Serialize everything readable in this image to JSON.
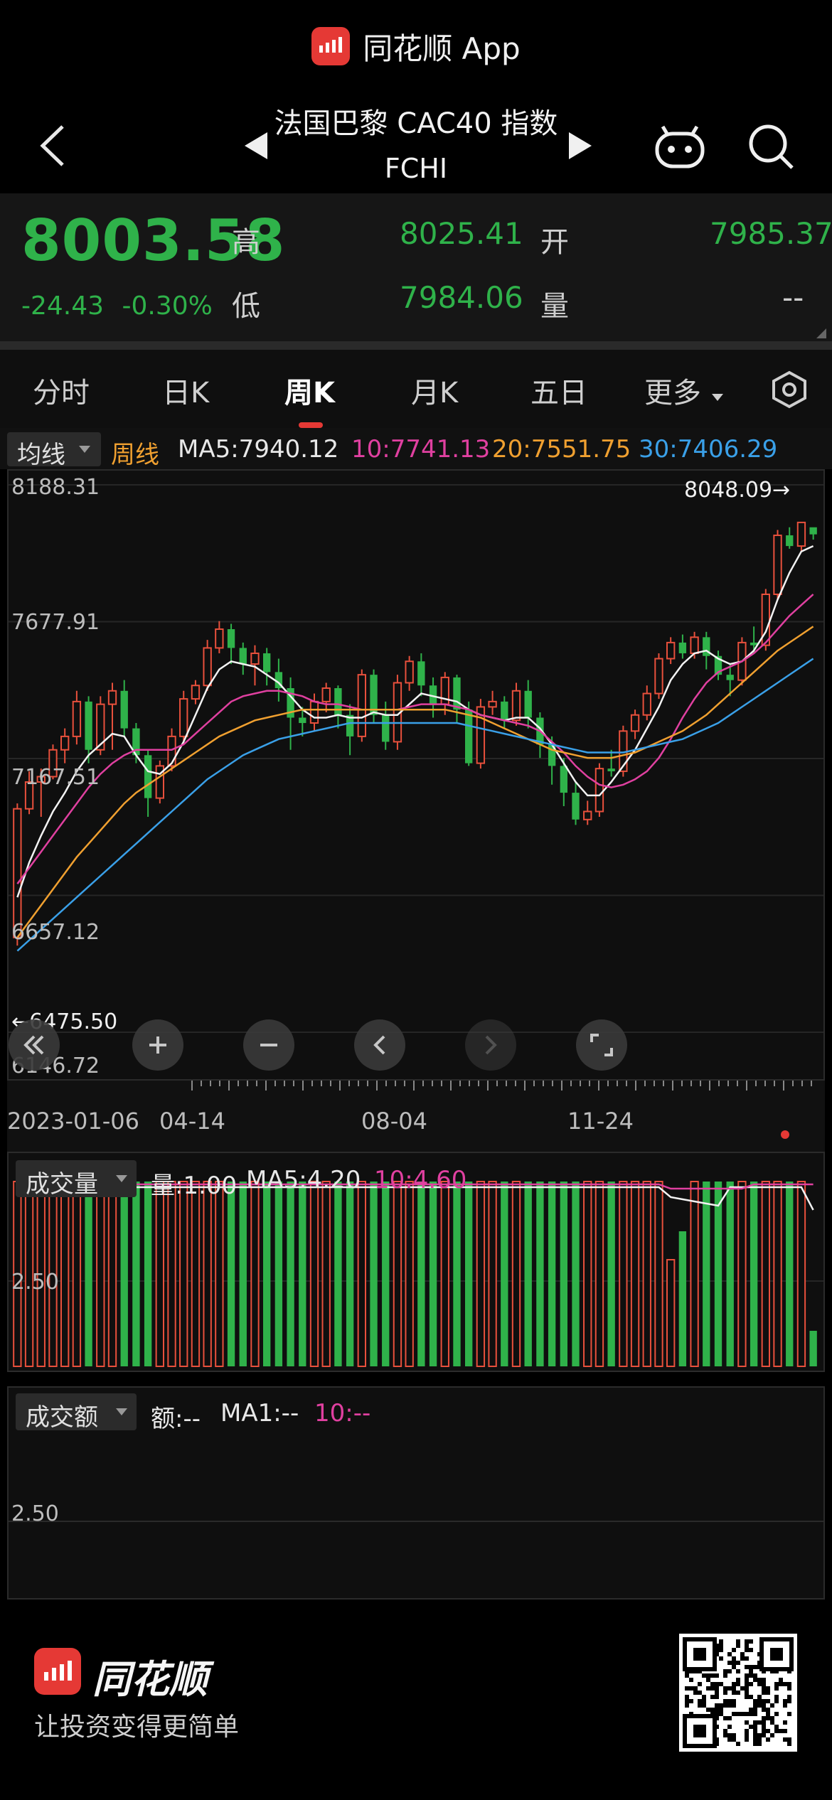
{
  "app": {
    "title": "同花顺 App"
  },
  "nav": {
    "title": "法国巴黎 CAC40 指数",
    "code": "FCHI"
  },
  "quote": {
    "price": "8003.58",
    "change": "-24.43",
    "change_pct": "-0.30%",
    "high_label": "高",
    "high": "8025.41",
    "open_label": "开",
    "open": "7985.37",
    "low_label": "低",
    "low": "7984.06",
    "volume_label": "量",
    "volume": "--"
  },
  "tabs": [
    {
      "label": "分时"
    },
    {
      "label": "日K"
    },
    {
      "label": "周K"
    },
    {
      "label": "月K"
    },
    {
      "label": "五日"
    },
    {
      "label": "更多"
    }
  ],
  "ma_row": {
    "dropdown": "均线",
    "period": "周线",
    "ma5": "MA5:7940.12",
    "ma10": "10:7741.13",
    "ma20": "20:7551.75",
    "ma30": "30:7406.29"
  },
  "colors": {
    "up": "#e8503c",
    "down": "#2fb24a",
    "ma5": "#f2f2f2",
    "ma10": "#e040a0",
    "ma20": "#f0a030",
    "ma30": "#3aa0e8",
    "accent": "#e53935"
  },
  "chart_data": {
    "type": "candlestick",
    "yaxis_labels": [
      "8188.31",
      "7677.91",
      "7167.51",
      "6657.12",
      "6146.72"
    ],
    "ylim": [
      6146.72,
      8188.31
    ],
    "max_marker": "8048.09→",
    "min_marker": "←6475.50",
    "date_labels": [
      "2023-01-06",
      "04-14",
      "08-04",
      "11-24"
    ],
    "candles": [
      [
        6500,
        6980,
        6470,
        7000
      ],
      [
        6980,
        7080,
        6960,
        7120
      ],
      [
        7080,
        7100,
        6950,
        7130
      ],
      [
        7100,
        7200,
        7090,
        7220
      ],
      [
        7200,
        7250,
        7150,
        7280
      ],
      [
        7250,
        7380,
        7220,
        7420
      ],
      [
        7380,
        7200,
        7150,
        7400
      ],
      [
        7200,
        7370,
        7180,
        7400
      ],
      [
        7370,
        7420,
        7200,
        7450
      ],
      [
        7420,
        7280,
        7250,
        7460
      ],
      [
        7280,
        7180,
        7150,
        7300
      ],
      [
        7180,
        7020,
        6950,
        7200
      ],
      [
        7020,
        7140,
        7000,
        7160
      ],
      [
        7140,
        7250,
        7120,
        7280
      ],
      [
        7250,
        7390,
        7230,
        7420
      ],
      [
        7390,
        7440,
        7370,
        7460
      ],
      [
        7440,
        7580,
        7420,
        7610
      ],
      [
        7580,
        7650,
        7560,
        7680
      ],
      [
        7650,
        7580,
        7520,
        7670
      ],
      [
        7580,
        7520,
        7480,
        7600
      ],
      [
        7520,
        7560,
        7440,
        7590
      ],
      [
        7560,
        7490,
        7440,
        7580
      ],
      [
        7490,
        7430,
        7380,
        7540
      ],
      [
        7430,
        7320,
        7200,
        7470
      ],
      [
        7320,
        7300,
        7250,
        7360
      ],
      [
        7300,
        7380,
        7270,
        7410
      ],
      [
        7380,
        7430,
        7340,
        7450
      ],
      [
        7430,
        7330,
        7280,
        7440
      ],
      [
        7330,
        7250,
        7180,
        7370
      ],
      [
        7250,
        7480,
        7230,
        7500
      ],
      [
        7480,
        7330,
        7300,
        7500
      ],
      [
        7330,
        7230,
        7200,
        7380
      ],
      [
        7230,
        7450,
        7200,
        7480
      ],
      [
        7450,
        7530,
        7420,
        7550
      ],
      [
        7530,
        7440,
        7400,
        7560
      ],
      [
        7440,
        7370,
        7320,
        7470
      ],
      [
        7370,
        7470,
        7330,
        7490
      ],
      [
        7470,
        7350,
        7300,
        7480
      ],
      [
        7350,
        7150,
        7140,
        7380
      ],
      [
        7150,
        7360,
        7130,
        7390
      ],
      [
        7360,
        7380,
        7330,
        7420
      ],
      [
        7380,
        7310,
        7280,
        7400
      ],
      [
        7310,
        7420,
        7290,
        7450
      ],
      [
        7420,
        7320,
        7280,
        7460
      ],
      [
        7320,
        7220,
        7170,
        7340
      ],
      [
        7220,
        7140,
        7070,
        7250
      ],
      [
        7140,
        7040,
        6990,
        7170
      ],
      [
        7040,
        6940,
        6920,
        7080
      ],
      [
        6940,
        6970,
        6920,
        7010
      ],
      [
        6970,
        7130,
        6950,
        7150
      ],
      [
        7130,
        7120,
        7100,
        7200
      ],
      [
        7120,
        7270,
        7100,
        7290
      ],
      [
        7270,
        7330,
        7240,
        7350
      ],
      [
        7330,
        7410,
        7310,
        7440
      ],
      [
        7410,
        7540,
        7390,
        7560
      ],
      [
        7540,
        7600,
        7520,
        7620
      ],
      [
        7600,
        7560,
        7540,
        7630
      ],
      [
        7560,
        7620,
        7540,
        7640
      ],
      [
        7620,
        7550,
        7500,
        7640
      ],
      [
        7550,
        7480,
        7460,
        7570
      ],
      [
        7480,
        7460,
        7400,
        7520
      ],
      [
        7460,
        7600,
        7440,
        7620
      ],
      [
        7600,
        7590,
        7560,
        7660
      ],
      [
        7590,
        7780,
        7570,
        7800
      ],
      [
        7780,
        8000,
        7760,
        8020
      ],
      [
        8000,
        7960,
        7950,
        8030
      ],
      [
        7960,
        8048.09,
        7940,
        8048.09
      ],
      [
        8030,
        8003.58,
        7984.06,
        8025.41
      ]
    ],
    "ma_lines": {
      "ma5": [
        6650,
        6780,
        6880,
        6970,
        7040,
        7120,
        7180,
        7220,
        7260,
        7250,
        7180,
        7120,
        7110,
        7150,
        7230,
        7330,
        7430,
        7500,
        7530,
        7520,
        7510,
        7480,
        7450,
        7400,
        7350,
        7320,
        7320,
        7330,
        7320,
        7320,
        7340,
        7330,
        7330,
        7370,
        7410,
        7400,
        7390,
        7380,
        7350,
        7330,
        7320,
        7310,
        7320,
        7320,
        7280,
        7220,
        7150,
        7080,
        7030,
        7030,
        7080,
        7140,
        7200,
        7280,
        7360,
        7460,
        7520,
        7560,
        7570,
        7540,
        7520,
        7530,
        7570,
        7640,
        7760,
        7860,
        7940,
        7960
      ],
      "ma10": [
        6700,
        6760,
        6820,
        6880,
        6940,
        7000,
        7060,
        7110,
        7150,
        7180,
        7200,
        7200,
        7200,
        7200,
        7220,
        7260,
        7300,
        7340,
        7380,
        7400,
        7410,
        7420,
        7420,
        7410,
        7400,
        7380,
        7370,
        7370,
        7360,
        7350,
        7350,
        7350,
        7350,
        7360,
        7370,
        7370,
        7370,
        7360,
        7350,
        7330,
        7320,
        7310,
        7300,
        7290,
        7270,
        7230,
        7190,
        7140,
        7100,
        7070,
        7060,
        7070,
        7090,
        7120,
        7170,
        7240,
        7320,
        7390,
        7450,
        7490,
        7510,
        7530,
        7560,
        7600,
        7650,
        7700,
        7740,
        7780
      ],
      "ma20": [
        6500,
        6560,
        6620,
        6680,
        6740,
        6800,
        6850,
        6900,
        6950,
        7000,
        7040,
        7070,
        7100,
        7130,
        7160,
        7190,
        7220,
        7250,
        7270,
        7290,
        7310,
        7320,
        7330,
        7340,
        7350,
        7350,
        7350,
        7350,
        7350,
        7350,
        7350,
        7350,
        7350,
        7350,
        7350,
        7350,
        7350,
        7340,
        7330,
        7320,
        7300,
        7280,
        7260,
        7240,
        7220,
        7200,
        7190,
        7180,
        7170,
        7170,
        7170,
        7180,
        7190,
        7210,
        7230,
        7250,
        7270,
        7300,
        7330,
        7370,
        7410,
        7450,
        7490,
        7530,
        7570,
        7600,
        7630,
        7660
      ],
      "ma30": [
        6450,
        6490,
        6530,
        6570,
        6610,
        6650,
        6690,
        6730,
        6770,
        6810,
        6850,
        6890,
        6930,
        6970,
        7010,
        7050,
        7090,
        7120,
        7150,
        7180,
        7200,
        7220,
        7240,
        7250,
        7260,
        7270,
        7280,
        7290,
        7300,
        7300,
        7300,
        7300,
        7300,
        7300,
        7300,
        7300,
        7300,
        7300,
        7290,
        7280,
        7270,
        7260,
        7250,
        7240,
        7230,
        7220,
        7210,
        7200,
        7190,
        7190,
        7190,
        7190,
        7200,
        7210,
        7220,
        7230,
        7240,
        7260,
        7280,
        7300,
        7330,
        7360,
        7390,
        7420,
        7450,
        7480,
        7510,
        7540
      ]
    }
  },
  "volume_panel": {
    "dropdown": "成交量",
    "vol": "量:1.00",
    "ma5": "MA5:4.20",
    "ma10": "10:4.60",
    "ylabel": "2.50"
  },
  "amount_panel": {
    "dropdown": "成交额",
    "amt": "额:--",
    "ma1": "MA1:--",
    "ma10": "10:--",
    "ylabel": "2.50"
  },
  "footer": {
    "brand": "同花顺",
    "slogan": "让投资变得更简单"
  }
}
